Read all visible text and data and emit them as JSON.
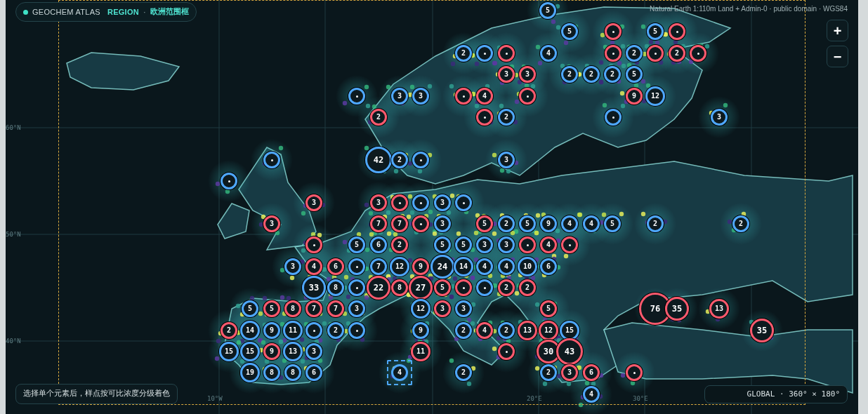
{
  "header": {
    "app": "GEOCHEM ATLAS",
    "mode": "REGION",
    "separator": "·",
    "region": "欧洲范围框"
  },
  "attribution": "Natural Earth 1:110m Land + Admin-0 · public domain · WGS84",
  "zoom_controls": [
    "+",
    "−"
  ],
  "axis_labels": [
    "60°N",
    "50°N",
    "40°N",
    "10°W",
    "20°E",
    "30°E"
  ],
  "clusters": [
    {
      "kind": "count",
      "label": "5",
      "color": "#4ea8ff",
      "selected": false
    },
    {
      "kind": "count",
      "label": "5",
      "color": "#4ea8ff",
      "selected": false
    },
    {
      "kind": "dot",
      "color": "#ff5a6e",
      "selected": false
    },
    {
      "kind": "count",
      "label": "5",
      "color": "#4ea8ff",
      "selected": false
    },
    {
      "kind": "dot",
      "color": "#ff5a6e",
      "selected": false
    },
    {
      "kind": "count",
      "label": "2",
      "color": "#4ea8ff",
      "selected": false
    },
    {
      "kind": "dot",
      "color": "#4ea8ff",
      "selected": false
    },
    {
      "kind": "dot",
      "color": "#ff5a6e",
      "selected": false
    },
    {
      "kind": "count",
      "label": "4",
      "color": "#4ea8ff",
      "selected": false
    },
    {
      "kind": "dot",
      "color": "#ff5a6e",
      "selected": false
    },
    {
      "kind": "count",
      "label": "2",
      "color": "#4ea8ff",
      "selected": false
    },
    {
      "kind": "dot",
      "color": "#ff5a6e",
      "selected": false
    },
    {
      "kind": "count",
      "label": "2",
      "color": "#ff5a6e",
      "selected": false
    },
    {
      "kind": "dot",
      "color": "#ff5a6e",
      "selected": false
    },
    {
      "kind": "count",
      "label": "3",
      "color": "#ff5a6e",
      "selected": false
    },
    {
      "kind": "count",
      "label": "3",
      "color": "#ff5a6e",
      "selected": false
    },
    {
      "kind": "count",
      "label": "2",
      "color": "#4ea8ff",
      "selected": false
    },
    {
      "kind": "count",
      "label": "2",
      "color": "#4ea8ff",
      "selected": false
    },
    {
      "kind": "count",
      "label": "2",
      "color": "#4ea8ff",
      "selected": false
    },
    {
      "kind": "count",
      "label": "5",
      "color": "#4ea8ff",
      "selected": false
    },
    {
      "kind": "dot",
      "color": "#4ea8ff",
      "selected": false
    },
    {
      "kind": "count",
      "label": "3",
      "color": "#4ea8ff",
      "selected": false
    },
    {
      "kind": "count",
      "label": "3",
      "color": "#4ea8ff",
      "selected": false
    },
    {
      "kind": "dot",
      "color": "#ff5a6e",
      "selected": false
    },
    {
      "kind": "count",
      "label": "4",
      "color": "#ff5a6e",
      "selected": false
    },
    {
      "kind": "dot",
      "color": "#ff5a6e",
      "selected": false
    },
    {
      "kind": "count",
      "label": "9",
      "color": "#ff5a6e",
      "selected": false
    },
    {
      "kind": "count",
      "label": "12",
      "color": "#4ea8ff",
      "selected": false
    },
    {
      "kind": "count",
      "label": "2",
      "color": "#ff5a6e",
      "selected": false
    },
    {
      "kind": "dot",
      "color": "#ff5a6e",
      "selected": false
    },
    {
      "kind": "count",
      "label": "2",
      "color": "#4ea8ff",
      "selected": false
    },
    {
      "kind": "dot",
      "color": "#4ea8ff",
      "selected": false
    },
    {
      "kind": "count",
      "label": "3",
      "color": "#4ea8ff",
      "selected": false
    },
    {
      "kind": "dot",
      "color": "#4ea8ff",
      "selected": false
    },
    {
      "kind": "count",
      "label": "42",
      "color": "#4ea8ff",
      "selected": false
    },
    {
      "kind": "count",
      "label": "2",
      "color": "#4ea8ff",
      "selected": false
    },
    {
      "kind": "dot",
      "color": "#4ea8ff",
      "selected": false
    },
    {
      "kind": "count",
      "label": "3",
      "color": "#4ea8ff",
      "selected": false
    },
    {
      "kind": "dot",
      "color": "#4ea8ff",
      "selected": false
    },
    {
      "kind": "count",
      "label": "3",
      "color": "#ff5a6e",
      "selected": false
    },
    {
      "kind": "count",
      "label": "3",
      "color": "#ff5a6e",
      "selected": false
    },
    {
      "kind": "dot",
      "color": "#ff5a6e",
      "selected": false
    },
    {
      "kind": "dot",
      "color": "#4ea8ff",
      "selected": false
    },
    {
      "kind": "count",
      "label": "3",
      "color": "#4ea8ff",
      "selected": false
    },
    {
      "kind": "dot",
      "color": "#4ea8ff",
      "selected": false
    },
    {
      "kind": "count",
      "label": "3",
      "color": "#ff5a6e",
      "selected": false
    },
    {
      "kind": "count",
      "label": "7",
      "color": "#ff5a6e",
      "selected": false
    },
    {
      "kind": "count",
      "label": "7",
      "color": "#ff5a6e",
      "selected": false
    },
    {
      "kind": "dot",
      "color": "#ff5a6e",
      "selected": false
    },
    {
      "kind": "count",
      "label": "3",
      "color": "#4ea8ff",
      "selected": false
    },
    {
      "kind": "count",
      "label": "5",
      "color": "#ff5a6e",
      "selected": false
    },
    {
      "kind": "count",
      "label": "2",
      "color": "#4ea8ff",
      "selected": false
    },
    {
      "kind": "count",
      "label": "5",
      "color": "#4ea8ff",
      "selected": false
    },
    {
      "kind": "count",
      "label": "9",
      "color": "#4ea8ff",
      "selected": false
    },
    {
      "kind": "count",
      "label": "4",
      "color": "#4ea8ff",
      "selected": false
    },
    {
      "kind": "count",
      "label": "4",
      "color": "#4ea8ff",
      "selected": false
    },
    {
      "kind": "count",
      "label": "5",
      "color": "#4ea8ff",
      "selected": false
    },
    {
      "kind": "count",
      "label": "2",
      "color": "#4ea8ff",
      "selected": false
    },
    {
      "kind": "count",
      "label": "2",
      "color": "#4ea8ff",
      "selected": false
    },
    {
      "kind": "dot",
      "color": "#ff5a6e",
      "selected": false
    },
    {
      "kind": "count",
      "label": "5",
      "color": "#4ea8ff",
      "selected": false
    },
    {
      "kind": "count",
      "label": "6",
      "color": "#4ea8ff",
      "selected": false
    },
    {
      "kind": "count",
      "label": "2",
      "color": "#ff5a6e",
      "selected": false
    },
    {
      "kind": "count",
      "label": "5",
      "color": "#4ea8ff",
      "selected": false
    },
    {
      "kind": "count",
      "label": "5",
      "color": "#4ea8ff",
      "selected": false
    },
    {
      "kind": "count",
      "label": "3",
      "color": "#4ea8ff",
      "selected": false
    },
    {
      "kind": "count",
      "label": "3",
      "color": "#4ea8ff",
      "selected": false
    },
    {
      "kind": "dot",
      "color": "#ff5a6e",
      "selected": false
    },
    {
      "kind": "count",
      "label": "4",
      "color": "#ff5a6e",
      "selected": false
    },
    {
      "kind": "dot",
      "color": "#ff5a6e",
      "selected": false
    },
    {
      "kind": "count",
      "label": "3",
      "color": "#4ea8ff",
      "selected": false
    },
    {
      "kind": "count",
      "label": "4",
      "color": "#ff5a6e",
      "selected": false
    },
    {
      "kind": "count",
      "label": "6",
      "color": "#ff5a6e",
      "selected": false
    },
    {
      "kind": "dot",
      "color": "#4ea8ff",
      "selected": false
    },
    {
      "kind": "count",
      "label": "7",
      "color": "#4ea8ff",
      "selected": false
    },
    {
      "kind": "count",
      "label": "12",
      "color": "#4ea8ff",
      "selected": false
    },
    {
      "kind": "count",
      "label": "9",
      "color": "#ff5a6e",
      "selected": false
    },
    {
      "kind": "count",
      "label": "24",
      "color": "#4ea8ff",
      "selected": false
    },
    {
      "kind": "count",
      "label": "14",
      "color": "#4ea8ff",
      "selected": false
    },
    {
      "kind": "count",
      "label": "4",
      "color": "#4ea8ff",
      "selected": false
    },
    {
      "kind": "count",
      "label": "4",
      "color": "#4ea8ff",
      "selected": false
    },
    {
      "kind": "count",
      "label": "10",
      "color": "#4ea8ff",
      "selected": false
    },
    {
      "kind": "count",
      "label": "6",
      "color": "#4ea8ff",
      "selected": false
    },
    {
      "kind": "count",
      "label": "33",
      "color": "#4ea8ff",
      "selected": false
    },
    {
      "kind": "count",
      "label": "8",
      "color": "#4ea8ff",
      "selected": false
    },
    {
      "kind": "dot",
      "color": "#4ea8ff",
      "selected": false
    },
    {
      "kind": "count",
      "label": "22",
      "color": "#ff5a6e",
      "selected": false
    },
    {
      "kind": "count",
      "label": "8",
      "color": "#ff5a6e",
      "selected": false
    },
    {
      "kind": "count",
      "label": "27",
      "color": "#ff5a6e",
      "selected": false
    },
    {
      "kind": "count",
      "label": "5",
      "color": "#ff5a6e",
      "selected": false
    },
    {
      "kind": "dot",
      "color": "#ff5a6e",
      "selected": false
    },
    {
      "kind": "dot",
      "color": "#4ea8ff",
      "selected": false
    },
    {
      "kind": "count",
      "label": "2",
      "color": "#ff5a6e",
      "selected": false
    },
    {
      "kind": "count",
      "label": "2",
      "color": "#ff5a6e",
      "selected": false
    },
    {
      "kind": "count",
      "label": "5",
      "color": "#4ea8ff",
      "selected": false
    },
    {
      "kind": "count",
      "label": "5",
      "color": "#ff5a6e",
      "selected": false
    },
    {
      "kind": "count",
      "label": "8",
      "color": "#ff5a6e",
      "selected": false
    },
    {
      "kind": "count",
      "label": "7",
      "color": "#ff5a6e",
      "selected": false
    },
    {
      "kind": "count",
      "label": "7",
      "color": "#ff5a6e",
      "selected": false
    },
    {
      "kind": "count",
      "label": "3",
      "color": "#4ea8ff",
      "selected": false
    },
    {
      "kind": "count",
      "label": "12",
      "color": "#4ea8ff",
      "selected": false
    },
    {
      "kind": "count",
      "label": "3",
      "color": "#ff5a6e",
      "selected": false
    },
    {
      "kind": "count",
      "label": "3",
      "color": "#4ea8ff",
      "selected": false
    },
    {
      "kind": "count",
      "label": "5",
      "color": "#ff5a6e",
      "selected": false
    },
    {
      "kind": "count",
      "label": "76",
      "color": "#ff5a6e",
      "selected": false
    },
    {
      "kind": "count",
      "label": "35",
      "color": "#ff5a6e",
      "selected": false
    },
    {
      "kind": "count",
      "label": "13",
      "color": "#ff5a6e",
      "selected": false
    },
    {
      "kind": "count",
      "label": "2",
      "color": "#ff5a6e",
      "selected": false
    },
    {
      "kind": "count",
      "label": "14",
      "color": "#4ea8ff",
      "selected": false
    },
    {
      "kind": "count",
      "label": "9",
      "color": "#4ea8ff",
      "selected": false
    },
    {
      "kind": "count",
      "label": "11",
      "color": "#4ea8ff",
      "selected": false
    },
    {
      "kind": "dot",
      "color": "#4ea8ff",
      "selected": false
    },
    {
      "kind": "count",
      "label": "2",
      "color": "#4ea8ff",
      "selected": false
    },
    {
      "kind": "dot",
      "color": "#4ea8ff",
      "selected": false
    },
    {
      "kind": "count",
      "label": "9",
      "color": "#4ea8ff",
      "selected": false
    },
    {
      "kind": "count",
      "label": "2",
      "color": "#4ea8ff",
      "selected": false
    },
    {
      "kind": "count",
      "label": "4",
      "color": "#ff5a6e",
      "selected": false
    },
    {
      "kind": "count",
      "label": "2",
      "color": "#4ea8ff",
      "selected": false
    },
    {
      "kind": "count",
      "label": "13",
      "color": "#ff5a6e",
      "selected": false
    },
    {
      "kind": "count",
      "label": "12",
      "color": "#ff5a6e",
      "selected": false
    },
    {
      "kind": "count",
      "label": "15",
      "color": "#4ea8ff",
      "selected": false
    },
    {
      "kind": "count",
      "label": "35",
      "color": "#ff5a6e",
      "selected": false
    },
    {
      "kind": "count",
      "label": "15",
      "color": "#4ea8ff",
      "selected": false
    },
    {
      "kind": "count",
      "label": "15",
      "color": "#4ea8ff",
      "selected": false
    },
    {
      "kind": "count",
      "label": "9",
      "color": "#ff5a6e",
      "selected": false
    },
    {
      "kind": "count",
      "label": "13",
      "color": "#4ea8ff",
      "selected": false
    },
    {
      "kind": "count",
      "label": "3",
      "color": "#4ea8ff",
      "selected": false
    },
    {
      "kind": "count",
      "label": "11",
      "color": "#ff5a6e",
      "selected": false
    },
    {
      "kind": "dot",
      "color": "#ff5a6e",
      "selected": false
    },
    {
      "kind": "count",
      "label": "30",
      "color": "#ff5a6e",
      "selected": false
    },
    {
      "kind": "count",
      "label": "43",
      "color": "#ff5a6e",
      "selected": false
    },
    {
      "kind": "count",
      "label": "19",
      "color": "#4ea8ff",
      "selected": false
    },
    {
      "kind": "count",
      "label": "8",
      "color": "#4ea8ff",
      "selected": false
    },
    {
      "kind": "count",
      "label": "8",
      "color": "#4ea8ff",
      "selected": false
    },
    {
      "kind": "count",
      "label": "6",
      "color": "#4ea8ff",
      "selected": false
    },
    {
      "kind": "count",
      "label": "4",
      "color": "#4ea8ff",
      "selected": true
    },
    {
      "kind": "count",
      "label": "2",
      "color": "#4ea8ff",
      "selected": false
    },
    {
      "kind": "count",
      "label": "2",
      "color": "#4ea8ff",
      "selected": false
    },
    {
      "kind": "count",
      "label": "3",
      "color": "#ff5a6e",
      "selected": false
    },
    {
      "kind": "count",
      "label": "6",
      "color": "#ff5a6e",
      "selected": false
    },
    {
      "kind": "dot",
      "color": "#ff5a6e",
      "selected": false
    },
    {
      "kind": "count",
      "label": "4",
      "color": "#4ea8ff",
      "selected": false
    }
  ],
  "hint": "选择单个元素后，样点按可比浓度分级着色",
  "extent": "GLOBAL · 360° × 180°"
}
